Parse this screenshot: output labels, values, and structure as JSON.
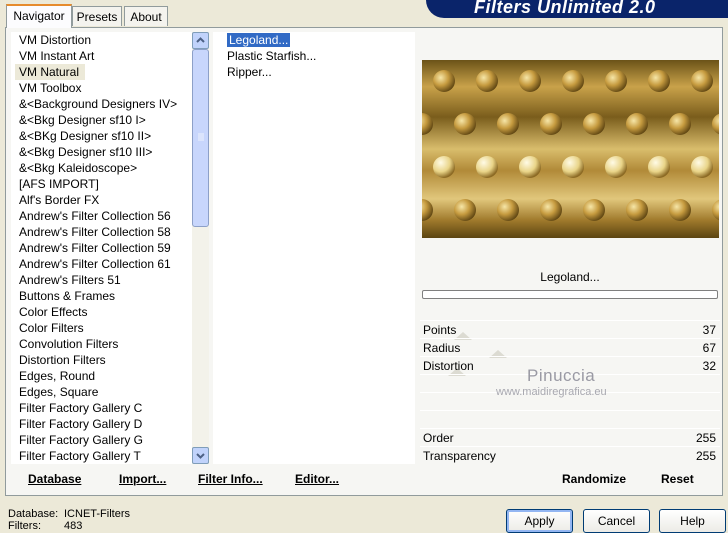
{
  "header": {
    "title": "Filters Unlimited 2.0"
  },
  "tabs": [
    {
      "label": "Navigator"
    },
    {
      "label": "Presets"
    },
    {
      "label": "About"
    }
  ],
  "categories": [
    "VM Distortion",
    "VM Instant Art",
    "VM Natural",
    "VM Toolbox",
    "&<Background Designers IV>",
    "&<Bkg Designer sf10 I>",
    "&<BKg Designer sf10 II>",
    "&<Bkg Designer sf10 III>",
    "&<Bkg Kaleidoscope>",
    "[AFS IMPORT]",
    "Alf's Border FX",
    "Andrew's Filter Collection 56",
    "Andrew's Filter Collection 58",
    "Andrew's Filter Collection 59",
    "Andrew's Filter Collection 61",
    "Andrew's Filters 51",
    "Buttons & Frames",
    "Color Effects",
    "Color Filters",
    "Convolution Filters",
    "Distortion Filters",
    "Edges, Round",
    "Edges, Square",
    "Filter Factory Gallery C",
    "Filter Factory Gallery D",
    "Filter Factory Gallery G",
    "Filter Factory Gallery T"
  ],
  "selected_category": "VM Natural",
  "filters": [
    "Legoland...",
    "Plastic Starfish...",
    "Ripper..."
  ],
  "selected_filter": "Legoland...",
  "left_buttons": {
    "database": "Database",
    "import": "Import...",
    "filter_info": "Filter Info...",
    "editor": "Editor..."
  },
  "preview": {
    "filter_name": "Legoland...",
    "watermark_name": "Pinuccia",
    "watermark_url": "www.maidiregrafica.eu"
  },
  "params": [
    {
      "name": "Points",
      "value": "37",
      "level": 0.145
    },
    {
      "name": "Radius",
      "value": "67",
      "level": 0.263
    },
    {
      "name": "Distortion",
      "value": "32",
      "level": 0.125
    },
    {
      "name": "",
      "value": "",
      "level": null
    },
    {
      "name": "",
      "value": "",
      "level": null
    },
    {
      "name": "",
      "value": "",
      "level": null
    },
    {
      "name": "Order",
      "value": "255",
      "level": null
    },
    {
      "name": "Transparency",
      "value": "255",
      "level": null
    }
  ],
  "right_buttons": {
    "randomize": "Randomize",
    "reset": "Reset"
  },
  "status": {
    "database_label": "Database:",
    "database_value": "ICNET-Filters",
    "filters_label": "Filters:",
    "filters_value": "483"
  },
  "dialog_buttons": {
    "apply": "Apply",
    "cancel": "Cancel",
    "help": "Help"
  },
  "colors": {
    "header_bg": "#0a246a",
    "selection": "#316ac5",
    "accent_tab": "#e68b2c"
  }
}
